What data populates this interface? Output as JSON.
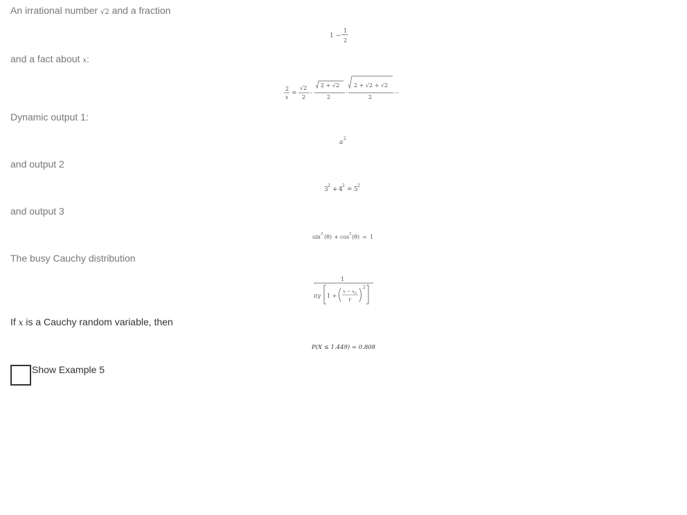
{
  "intro": {
    "prefix": "An irrational number",
    "sqrt_symbol": "√2",
    "suffix": "and a fraction"
  },
  "eq_fraction": {
    "lhs": "1 −",
    "num": "1",
    "den": "2"
  },
  "fact": {
    "prefix": "and a fact about",
    "var": "x",
    "suffix": ":"
  },
  "eq_viete": {
    "lhs_num": "2",
    "lhs_den": "x",
    "equals": "=",
    "t1_num": "√2",
    "t1_den": "2",
    "t2_num": "2 + √2",
    "t2_den": "2",
    "t3_num": "2 + √2 + √2",
    "t3_den": "2",
    "dot": "·",
    "ellipsis": "···"
  },
  "dynamic1": {
    "label": "Dynamic output 1:",
    "base": "a",
    "exp": "2"
  },
  "dynamic2": {
    "label": "and output 2",
    "a": "3",
    "b": "4",
    "c": "5",
    "exp": "2",
    "plus": "+",
    "equals": "="
  },
  "dynamic3": {
    "label": "and output 3",
    "sin": "sin",
    "cos": "cos",
    "exp": "2",
    "arg": "(θ)",
    "plus": "+",
    "equals": "=",
    "rhs": "1"
  },
  "cauchy": {
    "label": "The busy Cauchy distribution",
    "num": "1",
    "pi_gamma": "πγ",
    "one_plus": "1 +",
    "inner_num": "x − x",
    "inner_sub": "0",
    "inner_den": "γ",
    "exp": "2"
  },
  "cauchy_rv": {
    "prefix": "If",
    "var": "x",
    "suffix": "is a Cauchy random variable, then"
  },
  "probability": {
    "text": "P(X ≤ 1.449) = 0.808"
  },
  "example5": {
    "label": "Show Example 5",
    "checked": false
  }
}
